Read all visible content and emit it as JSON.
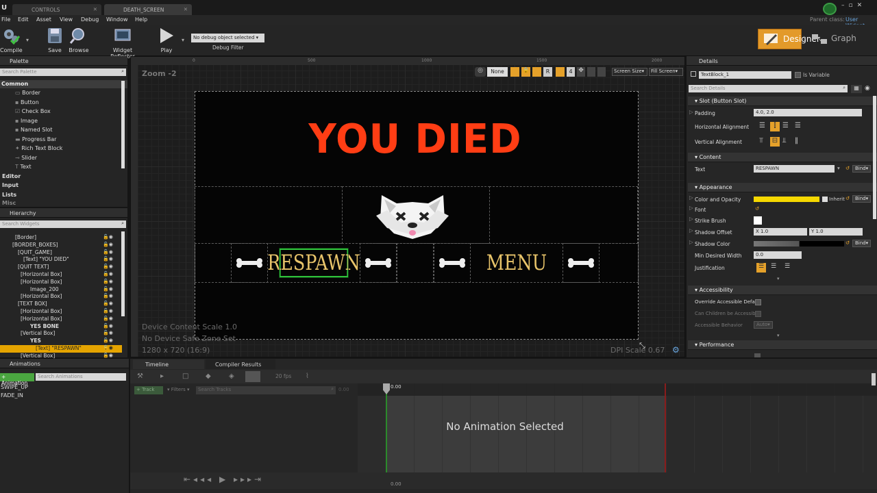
{
  "tabs": [
    {
      "label": "CONTROLS"
    },
    {
      "label": "DEATH_SCREEN"
    }
  ],
  "parent_class": {
    "label": "Parent class:",
    "value": "User Widget"
  },
  "menu": [
    "File",
    "Edit",
    "Asset",
    "View",
    "Debug",
    "Window",
    "Help"
  ],
  "toolbar": {
    "compile": "Compile",
    "save": "Save",
    "browse": "Browse",
    "reflector": "Widget Reflector",
    "play": "Play",
    "debug_select": "No debug object selected",
    "debug_filter": "Debug Filter"
  },
  "mode": {
    "designer": "Designer",
    "graph": "Graph"
  },
  "palette": {
    "title": "Palette",
    "search": "Search Palette",
    "common": "Common",
    "items": [
      "Border",
      "Button",
      "Check Box",
      "Image",
      "Named Slot",
      "Progress Bar",
      "Rich Text Block",
      "Slider",
      "Text"
    ],
    "categories": [
      "Editor",
      "Input",
      "Lists",
      "Misc"
    ]
  },
  "hierarchy": {
    "title": "Hierarchy",
    "search": "Search Widgets",
    "items": [
      "[Border]",
      "[BORDER_BOXES]",
      "[QUIT_GAME]",
      "[Text] \"YOU DIED\"",
      "[QUIT TEXT]",
      "[Horizontal Box]",
      "[Horizontal Box]",
      "Image_200",
      "[Horizontal Box]",
      "[TEXT BOX]",
      "[Horizontal Box]",
      "[Horizontal Box]",
      "YES BONE",
      "[Vertical Box]",
      "YES",
      "[Text] \"RESPAWN\"",
      "[Vertical Box]"
    ]
  },
  "viewport": {
    "zoom": "Zoom -2",
    "none_btn": "None",
    "r_btn": "R",
    "four_btn": "4",
    "screen_size": "Screen Size",
    "fill_screen": "Fill Screen",
    "ruler": [
      "0",
      "500",
      "1000",
      "1500",
      "2000"
    ],
    "scale_info": "Device Content Scale 1.0",
    "safe_zone": "No Device Safe Zone Set",
    "resolution": "1280 x 720 (16:9)",
    "dpi": "DPI Scale 0.67"
  },
  "canvas": {
    "title": "YOU DIED",
    "respawn": "RESPAWN",
    "menu": "MENU"
  },
  "details": {
    "title": "Details",
    "name": "TextBlock_1",
    "is_variable": "Is Variable",
    "search": "Search Details",
    "sections": {
      "slot": "Slot (Button Slot)",
      "content": "Content",
      "appearance": "Appearance",
      "accessibility": "Accessibility",
      "performance": "Performance"
    },
    "padding": {
      "label": "Padding",
      "value": "4.0, 2.0"
    },
    "h_align": "Horizontal Alignment",
    "v_align": "Vertical Alignment",
    "text": {
      "label": "Text",
      "value": "RESPAWN",
      "bind": "Bind"
    },
    "color": {
      "label": "Color and Opacity",
      "inherit": "Inherit",
      "bind": "Bind",
      "swatch": "#f5d800"
    },
    "font": "Font",
    "strike": "Strike Brush",
    "shadow_offset": {
      "label": "Shadow Offset",
      "x": "X 1.0",
      "y": "Y 1.0"
    },
    "shadow_color": {
      "label": "Shadow Color",
      "bind": "Bind"
    },
    "min_width": {
      "label": "Min Desired Width",
      "value": "0.0"
    },
    "justification": "Justification",
    "override": "Override Accessible Defa",
    "children": "Can Children be Accessib",
    "behavior": {
      "label": "Accessible Behavior",
      "value": "Auto"
    }
  },
  "bottom": {
    "animations_tab": "Animations",
    "add_anim": "+ Animation",
    "anim_search": "Search Animations",
    "anim_list": [
      "SWIPE_UP",
      "FADE_IN"
    ],
    "timeline_tab": "Timeline",
    "compiler_tab": "Compiler Results",
    "fps": "20 fps",
    "track": "+ Track",
    "filters": "Filters",
    "search_tracks": "Search Tracks",
    "time_start": "0.00",
    "time_cursor": "0.00",
    "no_anim": "No Animation Selected",
    "time_end": "0.00"
  },
  "colors": {
    "accent": "#e5a12a",
    "red_title": "#ff3d14",
    "yellow_text": "#e8c46a",
    "selection": "#e5a400"
  }
}
